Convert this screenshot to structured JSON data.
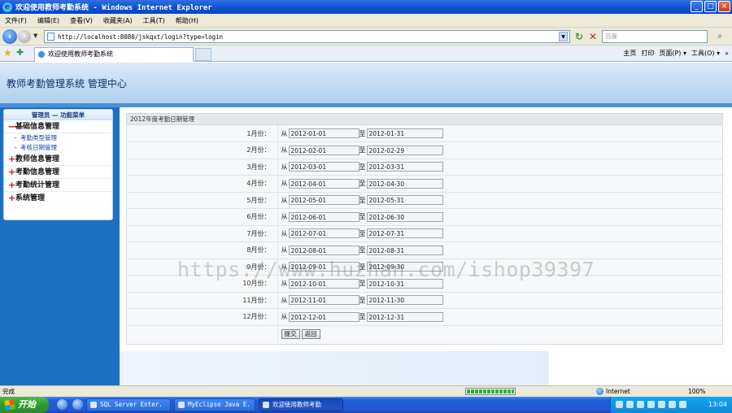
{
  "window": {
    "title": "欢迎使用教师考勤系统 - Windows Internet Explorer",
    "minimize": "_",
    "maximize": "□",
    "close": "×"
  },
  "menu": [
    "文件(F)",
    "编辑(E)",
    "查看(V)",
    "收藏夹(A)",
    "工具(T)",
    "帮助(H)"
  ],
  "address": {
    "url": "http://localhost:8080/jskqxt/login?type=login",
    "search_placeholder": "百度"
  },
  "tab": {
    "title": "欢迎使用教师考勤系统"
  },
  "commands": [
    "主页",
    "打印",
    "页面(P) ▾",
    "工具(O) ▾",
    "»"
  ],
  "header": {
    "site_title": "教师考勤管理系统  管理中心"
  },
  "sidebar": {
    "heading": "管理员 — 功能菜单",
    "groups": [
      {
        "sign": "—",
        "label": "基础信息管理",
        "items": [
          "考勤类型管理",
          "考核日期管理"
        ]
      },
      {
        "sign": "+",
        "label": "教师信息管理"
      },
      {
        "sign": "+",
        "label": "考勤信息管理"
      },
      {
        "sign": "+",
        "label": "考勤统计管理"
      },
      {
        "sign": "+",
        "label": "系统管理"
      }
    ]
  },
  "panel": {
    "title": "2012年度考勤日期管理",
    "from_label": "从",
    "to_label": "至",
    "rows": [
      {
        "month": "1月份：",
        "from": "2012-01-01",
        "to": "2012-01-31"
      },
      {
        "month": "2月份：",
        "from": "2012-02-01",
        "to": "2012-02-29"
      },
      {
        "month": "3月份：",
        "from": "2012-03-01",
        "to": "2012-03-31"
      },
      {
        "month": "4月份：",
        "from": "2012-04-01",
        "to": "2012-04-30"
      },
      {
        "month": "5月份：",
        "from": "2012-05-01",
        "to": "2012-05-31"
      },
      {
        "month": "6月份：",
        "from": "2012-06-01",
        "to": "2012-06-30"
      },
      {
        "month": "7月份：",
        "from": "2012-07-01",
        "to": "2012-07-31"
      },
      {
        "month": "8月份：",
        "from": "2012-08-01",
        "to": "2012-08-31"
      },
      {
        "month": "9月份：",
        "from": "2012-09-01",
        "to": "2012-09-30"
      },
      {
        "month": "10月份：",
        "from": "2012-10-01",
        "to": "2012-10-31"
      },
      {
        "month": "11月份：",
        "from": "2012-11-01",
        "to": "2012-11-30"
      },
      {
        "month": "12月份：",
        "from": "2012-12-01",
        "to": "2012-12-31"
      }
    ],
    "submit_label": "提交",
    "back_label": "返回"
  },
  "watermark": "https://www.huzhan.com/ishop39397",
  "status": {
    "left": "完成",
    "zone": "Internet",
    "zoom": "100%",
    "progress": 1.0
  },
  "taskbar": {
    "start": "开始",
    "tasks": [
      "SQL Server Enter.",
      "MyEclipse Java E.",
      "欢迎使用教师考勤"
    ],
    "clock": "13:04"
  }
}
